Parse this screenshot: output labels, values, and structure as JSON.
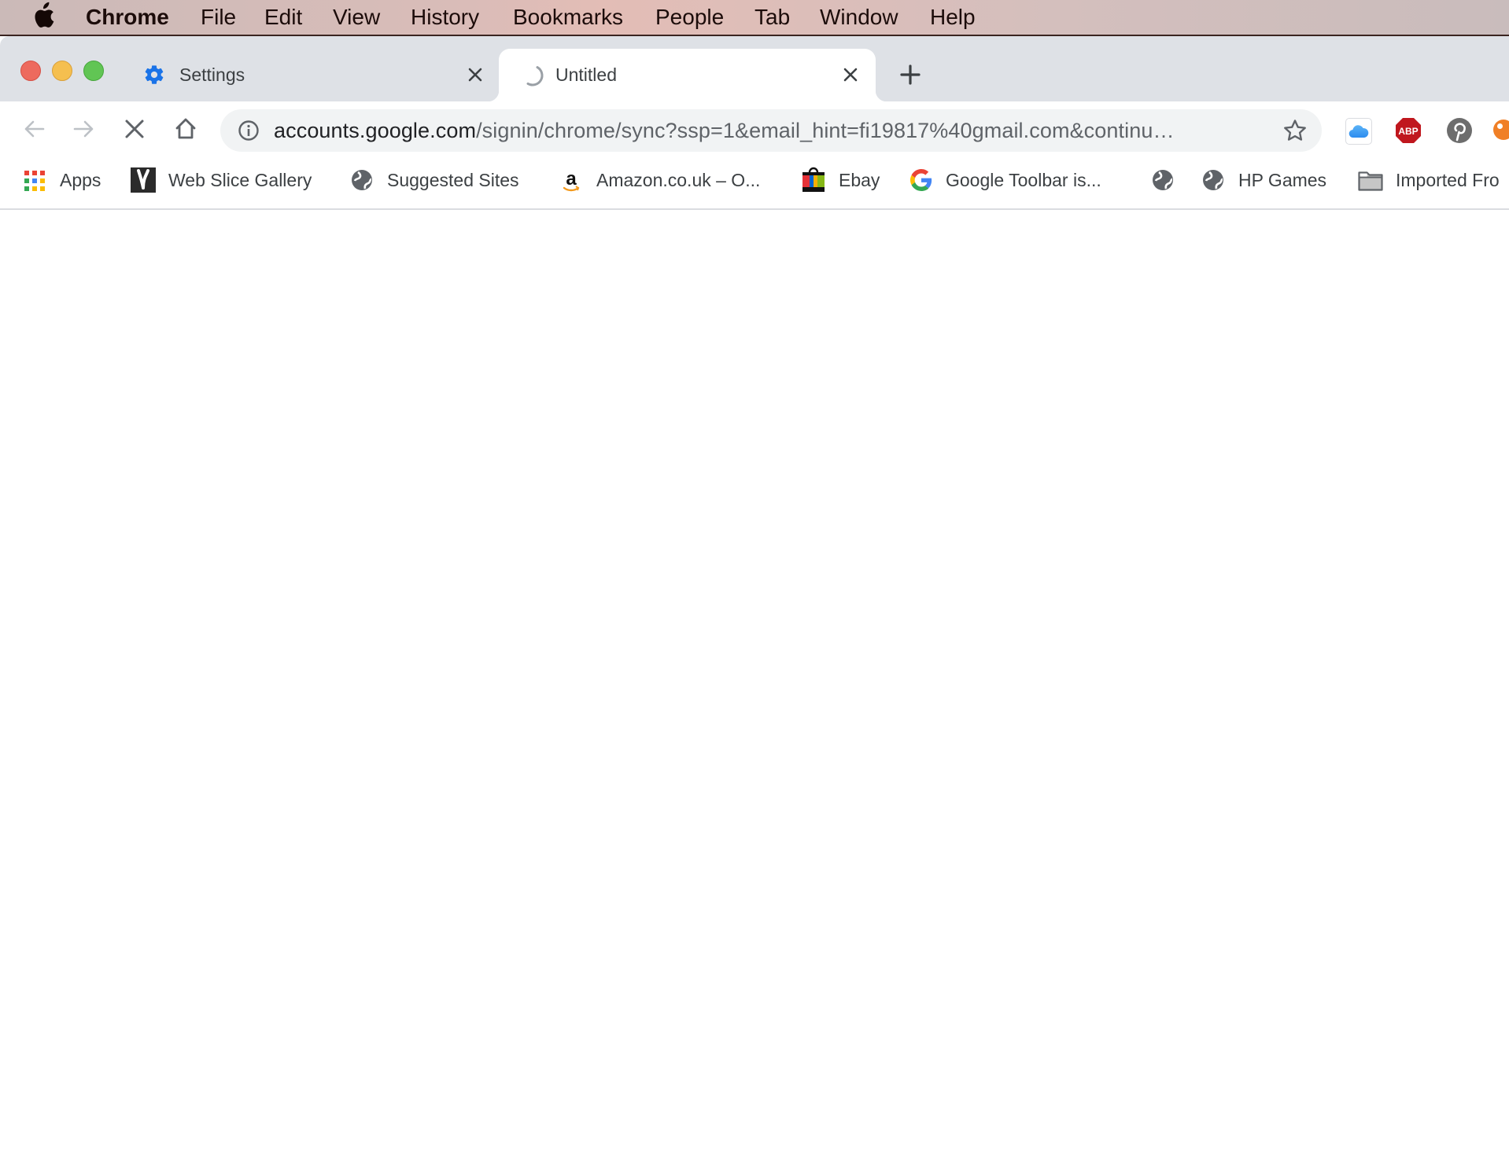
{
  "menubar": {
    "apple_icon": "apple-logo-icon",
    "app_name": "Chrome",
    "items": [
      "File",
      "Edit",
      "View",
      "History",
      "Bookmarks",
      "People",
      "Tab",
      "Window",
      "Help"
    ]
  },
  "window_controls": {
    "close_color": "#ed6a5e",
    "minimize_color": "#f5bf4f",
    "zoom_color": "#61c554"
  },
  "tabs": [
    {
      "title": "Settings",
      "icon": "gear-icon",
      "active": false,
      "close": "✕"
    },
    {
      "title": "Untitled",
      "icon": "loading-spinner-icon",
      "active": true,
      "close": "✕"
    }
  ],
  "new_tab": "+",
  "toolbar": {
    "back_enabled": false,
    "forward_enabled": false,
    "stop_icon": "stop-icon",
    "home_icon": "home-icon"
  },
  "omnibox": {
    "host": "accounts.google.com",
    "path": "/signin/chrome/sync?ssp=1&email_hint=fi19817%40gmail.com&continu…",
    "security_icon": "info-icon",
    "bookmark_icon": "star-icon"
  },
  "extensions": [
    {
      "name": "icloud-extension-icon"
    },
    {
      "name": "adblock-plus-extension-icon",
      "label": "ABP"
    },
    {
      "name": "pinterest-extension-icon"
    },
    {
      "name": "orange-extension-icon"
    }
  ],
  "bookmarks": [
    {
      "label": "Apps",
      "icon": "apps-grid-icon"
    },
    {
      "label": "Web Slice Gallery",
      "icon": "web-slice-icon"
    },
    {
      "label": "Suggested Sites",
      "icon": "globe-icon"
    },
    {
      "label": "Amazon.co.uk – O...",
      "icon": "amazon-icon"
    },
    {
      "label": "Ebay",
      "icon": "ebay-bag-icon"
    },
    {
      "label": "Google Toolbar is...",
      "icon": "google-g-icon"
    },
    {
      "label": "",
      "icon": "globe-icon"
    },
    {
      "label": "HP Games",
      "icon": "globe-icon"
    },
    {
      "label": "Imported Fro",
      "icon": "folder-icon"
    }
  ],
  "colors": {
    "tabstrip_bg": "#dee1e6",
    "omnibox_bg": "#f1f3f4",
    "accent_blue": "#1a73e8"
  }
}
